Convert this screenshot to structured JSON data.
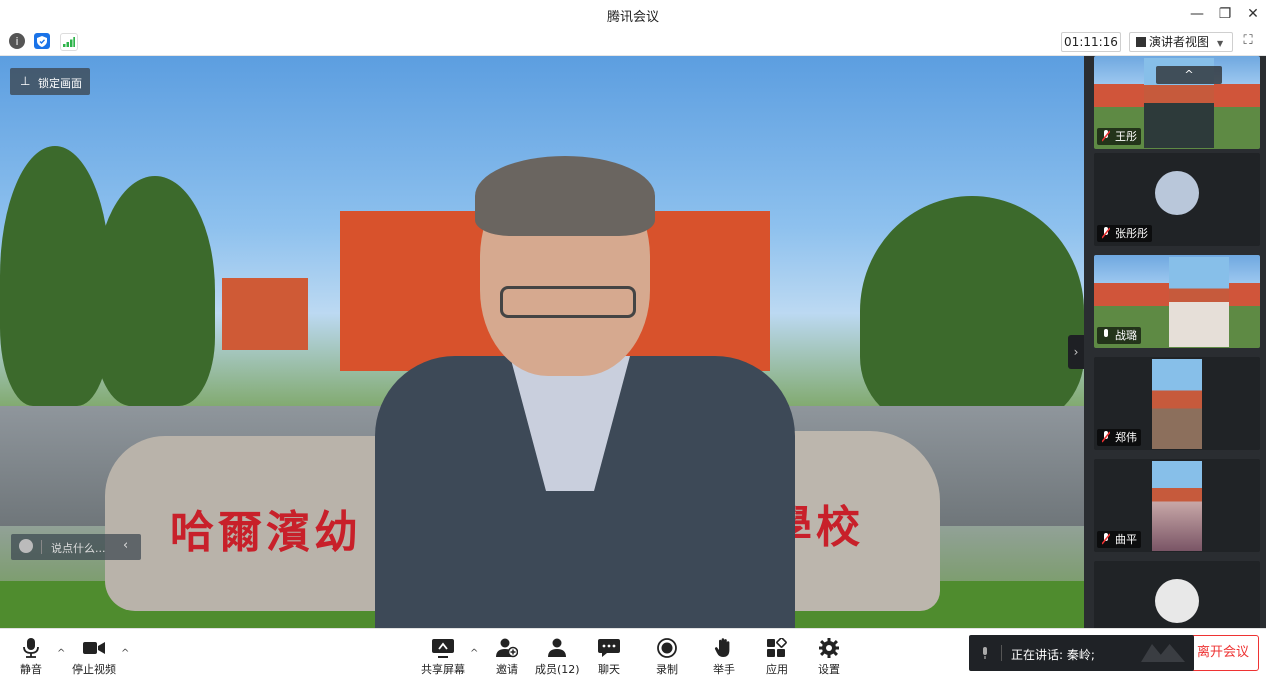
{
  "window": {
    "title": "腾讯会议",
    "minimize_symbol": "—",
    "restore_symbol": "❐",
    "close_symbol": "✕"
  },
  "toolbar": {
    "icons": [
      "info-icon",
      "shield-icon",
      "signal-icon"
    ],
    "timer": "01:11:16",
    "view_selector": "演讲者视图",
    "fullscreen_icon": "fullscreen-icon"
  },
  "main_video": {
    "lock_label": "锁定画面",
    "chat_placeholder": "说点什么...",
    "stone_text_left": "哈爾濱幼",
    "stone_text_right": "學校"
  },
  "sidebar": {
    "participants": [
      {
        "name": "王彤"
      },
      {
        "name": "张彤彤"
      },
      {
        "name": "战璐"
      },
      {
        "name": "郑伟"
      },
      {
        "name": "曲平"
      },
      {
        "name": ""
      }
    ],
    "scroll_up_symbol": "^",
    "collapse_symbol": "›"
  },
  "bottom_bar": {
    "mute": "静音",
    "stop_video": "停止视频",
    "share_screen": "共享屏幕",
    "invite": "邀请",
    "members": "成员(12)",
    "chat": "聊天",
    "record": "录制",
    "raise_hand": "举手",
    "apps": "应用",
    "settings": "设置",
    "caret_symbol": "^"
  },
  "speaking": {
    "text": "正在讲话: 秦岭;"
  },
  "leave": {
    "label": "离开会议"
  },
  "colors": {
    "accent_blue": "#1a73e8",
    "leave_red": "#e33333",
    "signal_green": "#2db34a"
  }
}
